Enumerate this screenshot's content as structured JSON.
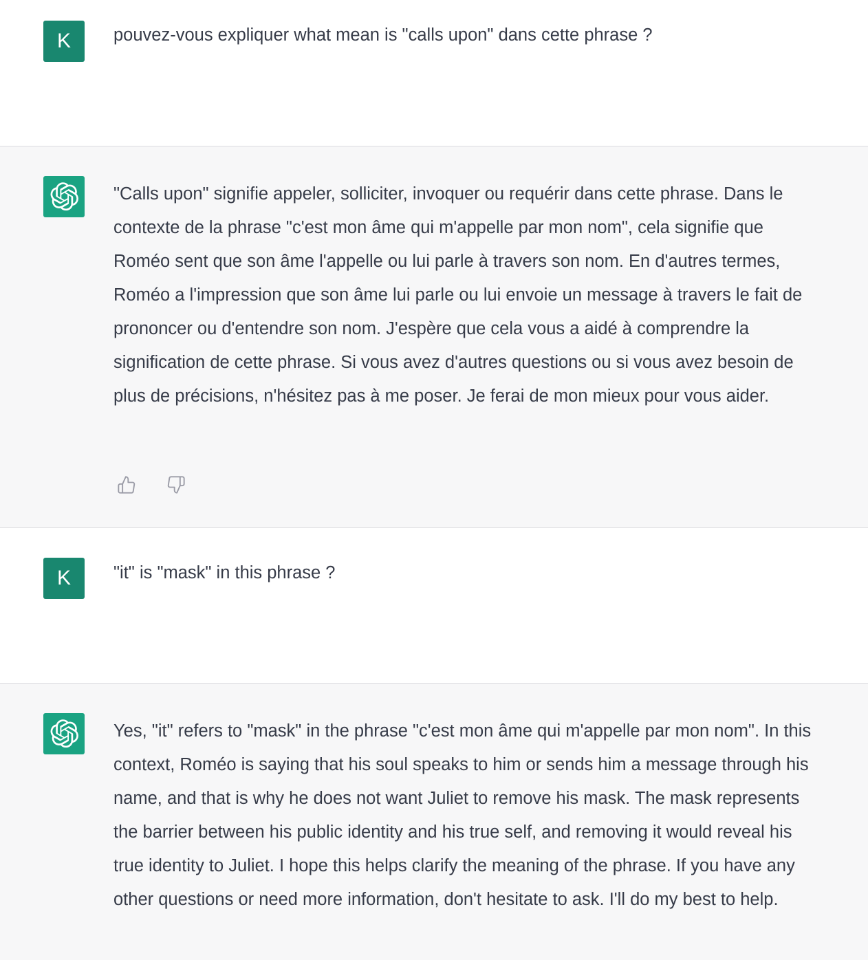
{
  "conversation": [
    {
      "role": "user",
      "avatar_initial": "K",
      "text": "pouvez-vous expliquer what mean is \"calls upon\" dans cette phrase ?"
    },
    {
      "role": "assistant",
      "avatar_icon": "openai-logo-icon",
      "text": "\"Calls upon\" signifie appeler, solliciter, invoquer ou requérir dans cette phrase. Dans le contexte de la phrase \"c'est mon âme qui m'appelle par mon nom\", cela signifie que Roméo sent que son âme l'appelle ou lui parle à travers son nom. En d'autres termes, Roméo a l'impression que son âme lui parle ou lui envoie un message à travers le fait de prononcer ou d'entendre son nom. J'espère que cela vous a aidé à comprendre la signification de cette phrase. Si vous avez d'autres questions ou si vous avez besoin de plus de précisions, n'hésitez pas à me poser. Je ferai de mon mieux pour vous aider.",
      "feedback_icons": [
        "thumbs-up-icon",
        "thumbs-down-icon"
      ]
    },
    {
      "role": "user",
      "avatar_initial": "K",
      "text": "\"it\" is \"mask\" in this phrase ?"
    },
    {
      "role": "assistant",
      "avatar_icon": "openai-logo-icon",
      "text": "Yes, \"it\" refers to \"mask\" in the phrase \"c'est mon âme qui m'appelle par mon nom\". In this context, Roméo is saying that his soul speaks to him or sends him a message through his name, and that is why he does not want Juliet to remove his mask. The mask represents the barrier between his public identity and his true self, and removing it would reveal his true identity to Juliet. I hope this helps clarify the meaning of the phrase. If you have any other questions or need more information, don't hesitate to ask. I'll do my best to help."
    }
  ],
  "colors": {
    "user_avatar_bg": "#19876f",
    "assistant_avatar_bg": "#1aa382",
    "assistant_row_bg": "#f7f7f8",
    "text": "#363b48"
  }
}
